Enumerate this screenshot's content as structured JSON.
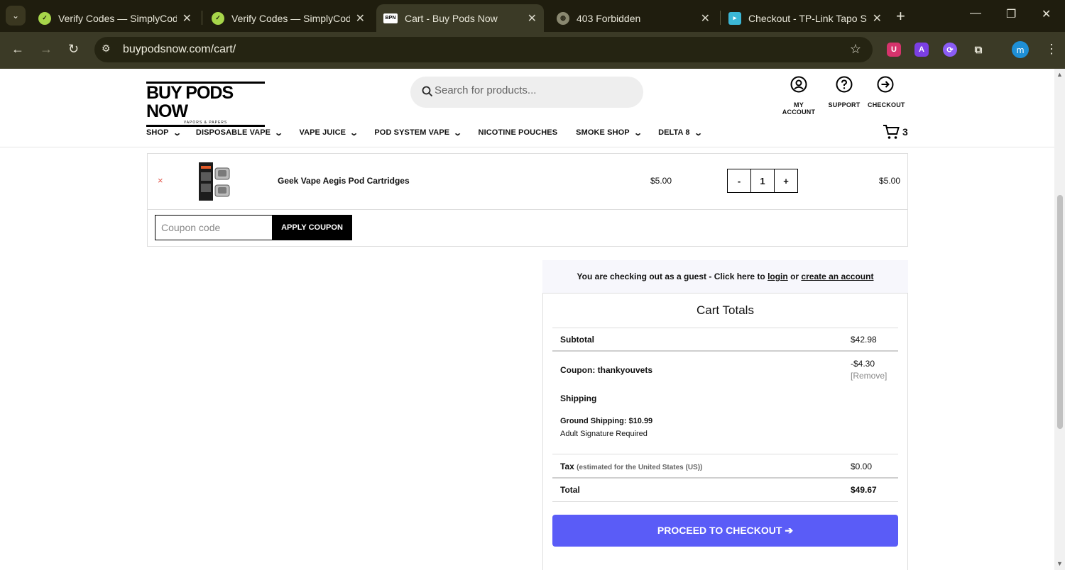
{
  "browser": {
    "tabs": [
      {
        "title": "Verify Codes — SimplyCodes",
        "favicon": "simplycodes-icon",
        "active": false
      },
      {
        "title": "Verify Codes — SimplyCodes",
        "favicon": "simplycodes-icon",
        "active": false
      },
      {
        "title": "Cart - Buy Pods Now",
        "favicon": "bpn-icon",
        "active": true
      },
      {
        "title": "403 Forbidden",
        "favicon": "globe-icon",
        "active": false
      },
      {
        "title": "Checkout - TP-Link Tapo Sto",
        "favicon": "tapo-icon",
        "active": false
      }
    ],
    "url": "buypodsnow.com/cart/",
    "profile_initial": "m"
  },
  "site": {
    "logo_text": "BUY PODS NOW",
    "logo_sub": "VAPORS & PAPERS",
    "search_placeholder": "Search for products...",
    "header_links": [
      {
        "label": "MY ACCOUNT",
        "icon": "user-icon"
      },
      {
        "label": "SUPPORT",
        "icon": "question-icon"
      },
      {
        "label": "CHECKOUT",
        "icon": "arrow-right-circle-icon"
      }
    ],
    "nav": [
      {
        "label": "SHOP",
        "has_dropdown": true
      },
      {
        "label": "DISPOSABLE VAPE",
        "has_dropdown": true
      },
      {
        "label": "VAPE JUICE",
        "has_dropdown": true
      },
      {
        "label": "POD SYSTEM VAPE",
        "has_dropdown": true
      },
      {
        "label": "NICOTINE POUCHES",
        "has_dropdown": false
      },
      {
        "label": "SMOKE SHOP",
        "has_dropdown": true
      },
      {
        "label": "DELTA 8",
        "has_dropdown": true
      }
    ],
    "cart_count": "3"
  },
  "cart": {
    "item": {
      "remove": "×",
      "name": "Geek Vape Aegis Pod Cartridges",
      "price": "$5.00",
      "qty": "1",
      "minus": "-",
      "plus": "+",
      "subtotal": "$5.00"
    },
    "coupon_placeholder": "Coupon code",
    "apply_coupon": "APPLY COUPON"
  },
  "guest": {
    "text": "You are checking out as a guest - Click here to",
    "login": "login",
    "or": "or",
    "create": "create an account"
  },
  "totals": {
    "title": "Cart Totals",
    "subtotal_label": "Subtotal",
    "subtotal_value": "$42.98",
    "coupon_label": "Coupon: thankyouvets",
    "coupon_value": "-$4.30",
    "coupon_remove": "[Remove]",
    "shipping_label": "Shipping",
    "shipping_method": "Ground Shipping: $10.99",
    "shipping_note": "Adult Signature Required",
    "tax_label": "Tax",
    "tax_note": "(estimated for the United States (US))",
    "tax_value": "$0.00",
    "total_label": "Total",
    "total_value": "$49.67",
    "checkout_button": "PROCEED TO CHECKOUT ➔",
    "button_color": "#5a5cf7"
  }
}
